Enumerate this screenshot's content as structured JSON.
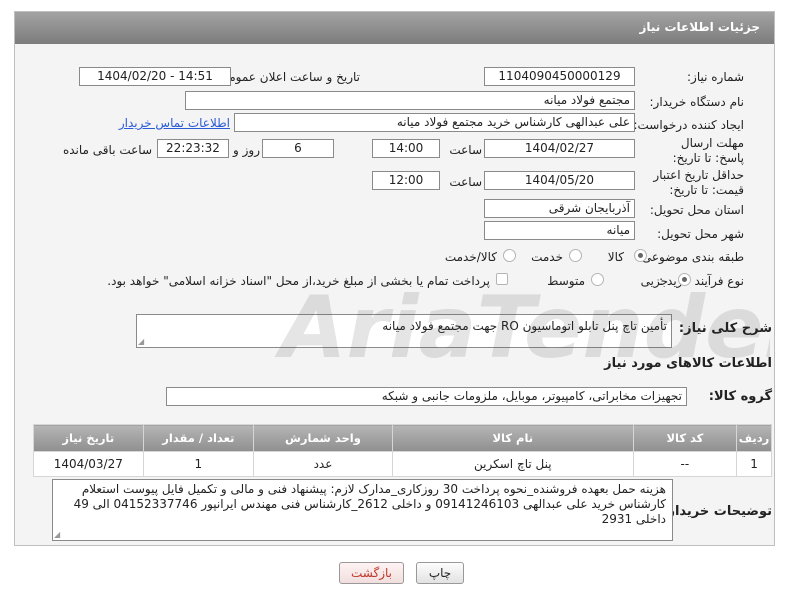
{
  "header": {
    "title": "جزئیات اطلاعات نیاز"
  },
  "form": {
    "need_number_label": "شماره نیاز:",
    "need_number": "1104090450000129",
    "announce_label": "تاریخ و ساعت اعلان عمومی:",
    "announce_value": "1404/02/20 - 14:51",
    "buyer_org_label": "نام دستگاه خریدار:",
    "buyer_org": "مجتمع فولاد میانه",
    "requester_label": "ایجاد کننده درخواست:",
    "requester": "علی عبدالهی کارشناس خرید مجتمع فولاد میانه",
    "contact_link": "اطلاعات تماس خریدار",
    "reply_deadline_label": "مهلت ارسال پاسخ: تا تاریخ:",
    "reply_date": "1404/02/27",
    "time_label": "ساعت",
    "reply_time": "14:00",
    "days_value": "6",
    "days_label": "روز و",
    "remaining_value": "22:23:32",
    "remaining_label": "ساعت باقی مانده",
    "price_validity_label": "حداقل تاریخ اعتبار قیمت: تا تاریخ:",
    "price_date": "1404/05/20",
    "price_time": "12:00",
    "province_label": "استان محل تحویل:",
    "province": "آذربایجان شرقی",
    "city_label": "شهر محل تحویل:",
    "city": "میانه",
    "category_label": "طبقه بندی موضوعی:",
    "category_options": [
      "کالا",
      "خدمت",
      "کالا/خدمت"
    ],
    "process_label": "نوع فرآیند خرید :",
    "process_options": [
      "جزیی",
      "متوسط"
    ],
    "payment_note": "پرداخت تمام یا بخشی از مبلغ خرید،از محل \"اسناد خزانه اسلامی\" خواهد بود.",
    "description_label": "شرح کلی نیاز:",
    "description": "تأمین تاچ پنل تابلو اتوماسیون RO جهت مجتمع فولاد میانه"
  },
  "goods": {
    "section_title": "اطلاعات کالاهای مورد نیاز",
    "group_label": "گروه کالا:",
    "group_value": "تجهیزات مخابراتی، کامپیوتر، موبایل، ملزومات جانبی و شبکه",
    "columns": [
      "ردیف",
      "کد کالا",
      "نام کالا",
      "واحد شمارش",
      "تعداد / مقدار",
      "تاریخ نیاز"
    ],
    "rows": [
      {
        "row": "1",
        "code": "--",
        "name": "پنل تاچ اسکرین",
        "unit": "عدد",
        "qty": "1",
        "date": "1404/03/27"
      }
    ]
  },
  "notes": {
    "label": "توضیحات خریدار:",
    "text": "هزینه حمل بعهده فروشنده_نحوه پرداخت 30 روزکاری_مدارک لازم: پیشنهاد فنی و مالی و تکمیل فایل پیوست استعلام کارشناس خرید علی عبدالهی 09141246103 و داخلی 2612_کارشناس فنی مهندس ایرانپور 04152337746 الی 49 داخلی 2931"
  },
  "buttons": {
    "print": "چاپ",
    "back": "بازگشت"
  },
  "colors": {
    "header_bg": "#8c8c8c",
    "link": "#2a5bd7",
    "back_text": "#c0392b"
  }
}
